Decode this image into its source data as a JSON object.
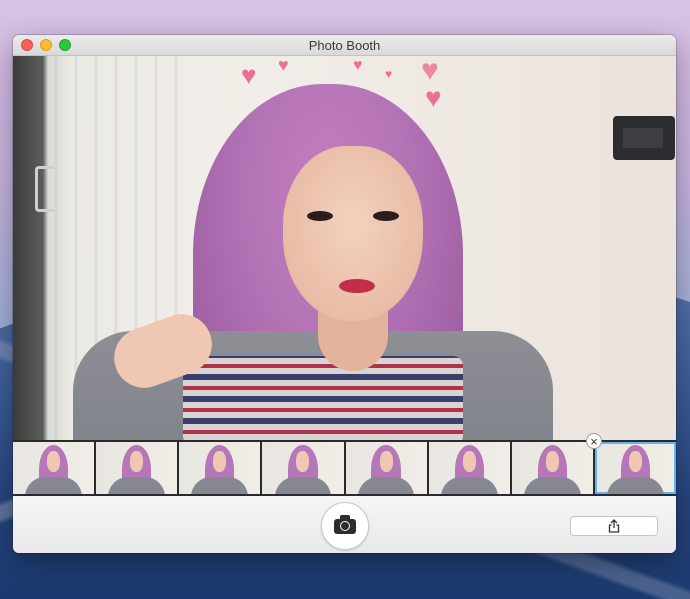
{
  "window": {
    "title": "Photo Booth"
  },
  "icons": {
    "close": "close-icon",
    "minimize": "minimize-icon",
    "zoom": "zoom-icon",
    "camera": "camera-icon",
    "share": "share-icon",
    "delete": "delete-icon"
  },
  "filmstrip": {
    "thumbnail_count": 8,
    "selected_index": 7,
    "delete_symbol": "×"
  },
  "colors": {
    "selection": "#5fb4f4",
    "heart": "#f06e95"
  }
}
